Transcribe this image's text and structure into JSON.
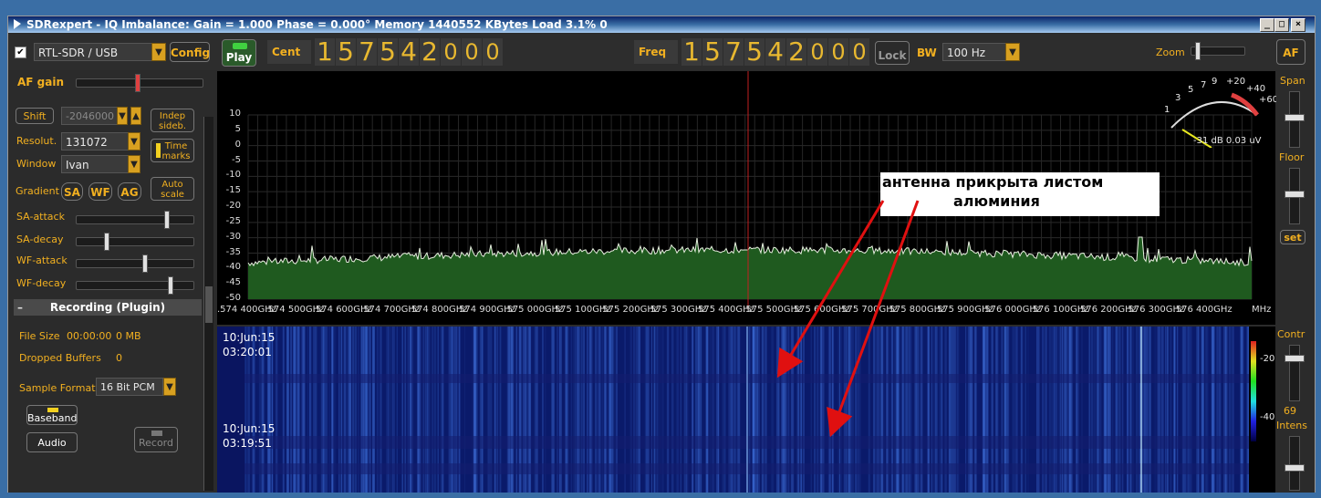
{
  "window": {
    "title": "SDRexpert - IQ Imbalance: Gain = 1.000 Phase = 0.000°  Memory 1440552 KBytes   Load 3.1%  0",
    "minimize": "_",
    "maximize": "□",
    "close": "×"
  },
  "toolbar": {
    "device": "RTL-SDR / USB",
    "config": "Config",
    "play": "Play",
    "cent_label": "Cent",
    "cent_digits": [
      "1",
      "5",
      "7",
      "5",
      "4",
      "2",
      "0",
      "0",
      "0"
    ],
    "freq_label": "Freq",
    "freq_digits": [
      "1",
      "5",
      "7",
      "5",
      "4",
      "2",
      "0",
      "0",
      "0"
    ],
    "lock": "Lock",
    "bw_label": "BW",
    "bw_value": "100 Hz",
    "zoom_label": "Zoom",
    "af_button": "AF"
  },
  "left_panel": {
    "af_gain": "AF gain",
    "shift": "Shift",
    "shift_value": "-2046000",
    "indep_sideb": [
      "Indep",
      "sideb."
    ],
    "resolut_label": "Resolut.",
    "resolut_value": "131072",
    "time_marks": [
      "Time",
      "marks"
    ],
    "window_label": "Window",
    "window_value": "Ivan",
    "gradient_label": "Gradient",
    "sa": "SA",
    "wf": "WF",
    "ag": "AG",
    "auto_scale": [
      "Auto",
      "scale"
    ],
    "sa_attack": "SA-attack",
    "sa_decay": "SA-decay",
    "wf_attack": "WF-attack",
    "wf_decay": "WF-decay",
    "recording": "Recording (Plugin)",
    "file_size_label": "File Size",
    "file_size_time": "00:00:00",
    "file_size_mb": "0 MB",
    "dropped_label": "Dropped Buffers",
    "dropped_value": "0",
    "sample_format_label": "Sample Format",
    "sample_format_value": "16 Bit PCM",
    "baseband": "Baseband",
    "audio": "Audio",
    "record": "Record"
  },
  "spectrum": {
    "y_ticks": [
      "10",
      "5",
      "0",
      "-5",
      "-10",
      "-15",
      "-20",
      "-25",
      "-30",
      "-35",
      "-40",
      "-45",
      "-50"
    ],
    "x_ticks": [
      ".574 400GHz",
      ".574 500GHz",
      ".574 600GHz",
      ".574 700GHz",
      ".574 800GHz",
      ".574 900GHz",
      ".575 000GHz",
      ".575 100GHz",
      ".575 200GHz",
      ".575 300GHz",
      ".575 400GHz",
      ".575 500GHz",
      ".575 600GHz",
      ".575 700GHz",
      ".575 800GHz",
      ".575 900GHz",
      ".576 000GHz",
      ".576 100GHz",
      ".576 200GHz",
      ".576 300GHz",
      ".576 400GHz"
    ],
    "x_unit": "MHz",
    "meter_scale": [
      "1",
      "3",
      "5",
      "7",
      "9",
      "+20",
      "+40",
      "+60"
    ],
    "meter_readout": "-31 dB 0.03 uV",
    "annotation_line1": "антенна прикрыта листом",
    "annotation_line2": "алюминия"
  },
  "waterfall": {
    "stamp1_date": "10:Jun:15",
    "stamp1_time": "03:20:01",
    "stamp2_date": "10:Jun:15",
    "stamp2_time": "03:19:51",
    "scale_top": "-20",
    "scale_bottom": "-40"
  },
  "right_panel": {
    "span": "Span",
    "floor": "Floor",
    "set": "set",
    "contr": "Contr",
    "contr_value": "69",
    "intens": "Intens"
  },
  "colors": {
    "accent": "#f2b020",
    "spectrum_fill": "#1f5a1f",
    "waterfall": "#0a1a6a",
    "cursor": "#c02020"
  }
}
